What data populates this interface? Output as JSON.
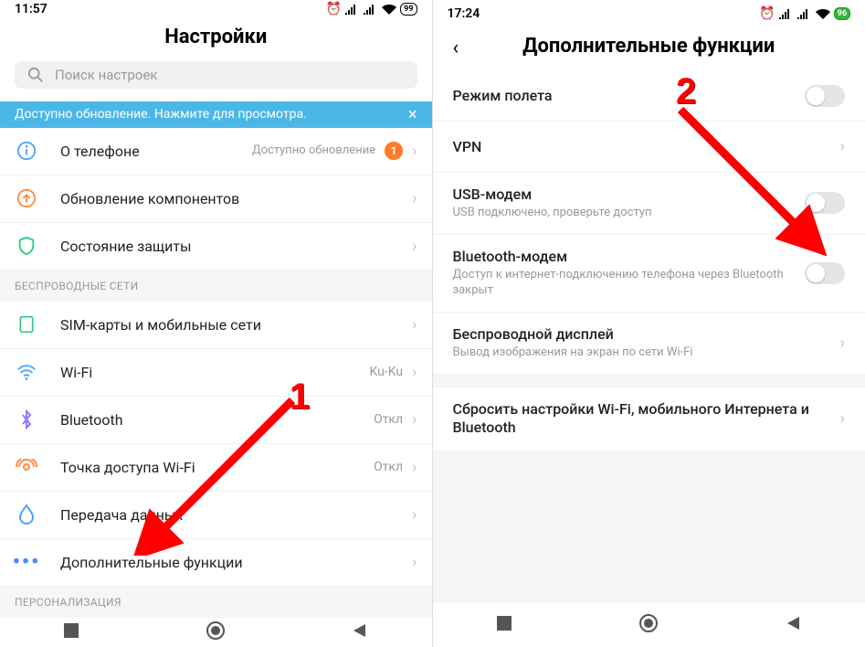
{
  "left": {
    "status_time": "11:57",
    "battery": "99",
    "title": "Настройки",
    "search_placeholder": "Поиск настроек",
    "banner": "Доступно обновление. Нажмите для просмотра.",
    "rows": {
      "about": {
        "label": "О телефоне",
        "note": "Доступно обновление",
        "badge": "1"
      },
      "components": {
        "label": "Обновление компонентов"
      },
      "security": {
        "label": "Состояние защиты"
      }
    },
    "section_wireless": "БЕСПРОВОДНЫЕ СЕТИ",
    "wireless": {
      "sim": {
        "label": "SIM-карты и мобильные сети"
      },
      "wifi": {
        "label": "Wi-Fi",
        "value": "Ku-Ku"
      },
      "bluetooth": {
        "label": "Bluetooth",
        "value": "Откл"
      },
      "hotspot": {
        "label": "Точка доступа Wi-Fi",
        "value": "Откл"
      },
      "data": {
        "label": "Передача данных"
      },
      "more": {
        "label": "Дополнительные функции"
      }
    },
    "section_personalization": "ПЕРСОНАЛИЗАЦИЯ"
  },
  "right": {
    "status_time": "17:24",
    "battery": "96",
    "title": "Дополнительные функции",
    "rows": {
      "airplane": {
        "label": "Режим полета"
      },
      "vpn": {
        "label": "VPN"
      },
      "usb": {
        "label": "USB-модем",
        "sub": "USB подключено, проверьте доступ"
      },
      "bt_modem": {
        "label": "Bluetooth-модем",
        "sub": "Доступ к интернет-подключению телефона через Bluetooth закрыт"
      },
      "cast": {
        "label": "Беспроводной дисплей",
        "sub": "Вывод изображения на экран по сети Wi-Fi"
      },
      "reset": {
        "label": "Сбросить настройки Wi-Fi, мобильного Интернета и Bluetooth"
      }
    }
  },
  "annotations": {
    "num1": "1",
    "num2": "2"
  }
}
